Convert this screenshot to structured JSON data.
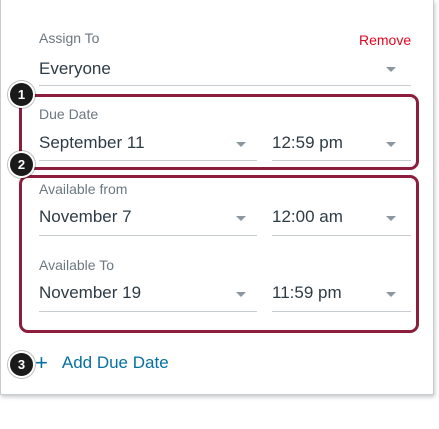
{
  "assign": {
    "label": "Assign To",
    "remove_label": "Remove",
    "value": "Everyone"
  },
  "due": {
    "label": "Due Date",
    "date": "September 11",
    "time": "12:59 pm"
  },
  "available_from": {
    "label": "Available from",
    "date": "November 7",
    "time": "12:00 am"
  },
  "available_to": {
    "label": "Available To",
    "date": "November 19",
    "time": "11:59 pm"
  },
  "add_due_date": {
    "plus": "+",
    "label": "Add Due Date"
  },
  "callouts": [
    "1",
    "2",
    "3"
  ],
  "colors": {
    "highlight_border": "#8c1d3c",
    "remove_link": "#e0061f",
    "link": "#0770a3",
    "badge": "#1a1a1a"
  },
  "icons": {
    "dropdown": "caret-down-icon",
    "add": "plus-icon"
  }
}
